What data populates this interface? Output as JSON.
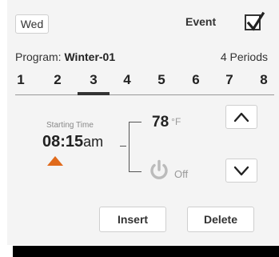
{
  "header": {
    "day_label": "Wed",
    "event_label": "Event",
    "event_checked": true
  },
  "program": {
    "prefix": "Program: ",
    "name": "Winter-01",
    "periods_label": "4 Periods"
  },
  "periods": {
    "tabs": [
      "1",
      "2",
      "3",
      "4",
      "5",
      "6",
      "7",
      "8"
    ],
    "active_index": 2
  },
  "schedule": {
    "starting_time_label": "Starting Time",
    "time": "08:15",
    "time_suffix": "am",
    "setpoint": "78",
    "unit": "°F",
    "off_label": "Off",
    "icons": {
      "time_marker": "triangle-up-icon",
      "power": "power-icon",
      "up": "chevron-up-icon",
      "down": "chevron-down-icon",
      "check": "checkmark-icon"
    },
    "accent_color": "#e06a1b",
    "power_color": "#bbbbbb"
  },
  "actions": {
    "insert_label": "Insert",
    "delete_label": "Delete"
  }
}
